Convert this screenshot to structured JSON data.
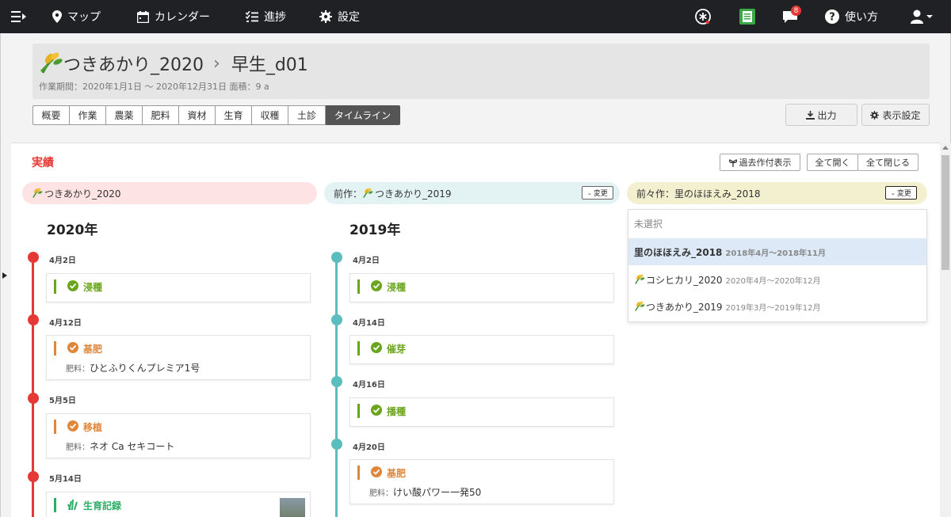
{
  "nav": {
    "map": "マップ",
    "calendar": "カレンダー",
    "progress": "進捗",
    "settings": "設定",
    "help": "使い方",
    "notification_count": "8"
  },
  "header": {
    "crop": "つきあかり_2020",
    "field": "早生_d01",
    "meta": "作業期間：2020年1月1日 ～ 2020年12月31日  面積：9 a"
  },
  "tabs": [
    "概要",
    "作業",
    "農薬",
    "肥料",
    "資材",
    "生育",
    "収穫",
    "土診",
    "タイムライン"
  ],
  "toolbar": {
    "export": "出力",
    "display_settings": "表示設定"
  },
  "section": {
    "title": "実績",
    "past_date_label": "過去作付表示",
    "expand_all": "全て開く",
    "collapse_all": "全て閉じる",
    "change": "変更"
  },
  "columns": [
    {
      "label": "つきあかり_2020",
      "year": "2020年",
      "color": "#e53935",
      "head_bg": "#fde3e3"
    },
    {
      "prefix": "前作：",
      "label": "つきあかり_2019",
      "year": "2019年",
      "color": "#5bbdbd",
      "head_bg": "#e3f3f3"
    },
    {
      "prefix": "前々作：",
      "label": "里のほほえみ_2018",
      "head_bg": "#f3f0cf"
    }
  ],
  "timeline_2020": [
    {
      "date": "4月2日",
      "title": "浸種",
      "color": "#6aa51e"
    },
    {
      "date": "4月12日",
      "title": "基肥",
      "color": "#e0863a",
      "sub_label": "肥料：",
      "sub": "ひとふりくんプレミア1号"
    },
    {
      "date": "5月5日",
      "title": "移植",
      "color": "#e0863a",
      "sub_label": "肥料：",
      "sub": "ネオ Ca セキコート"
    },
    {
      "date": "5月14日",
      "title": "生育記録",
      "color": "#2bae66"
    }
  ],
  "timeline_2019": [
    {
      "date": "4月2日",
      "title": "浸種",
      "color": "#6aa51e"
    },
    {
      "date": "4月14日",
      "title": "催芽",
      "color": "#6aa51e"
    },
    {
      "date": "4月16日",
      "title": "播種",
      "color": "#6aa51e"
    },
    {
      "date": "4月20日",
      "title": "基肥",
      "color": "#e0863a",
      "sub_label": "肥料：",
      "sub": "けい酸パワー一発50"
    }
  ],
  "dropdown": [
    {
      "label": "未選択",
      "sub": ""
    },
    {
      "label": "里のほほえみ_2018",
      "sub": "2018年4月～2018年11月"
    },
    {
      "label": "コシヒカリ_2020",
      "sub": "2020年4月～2020年12月"
    },
    {
      "label": "つきあかり_2019",
      "sub": "2019年3月～2019年12月"
    }
  ]
}
